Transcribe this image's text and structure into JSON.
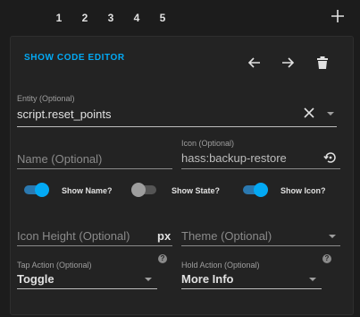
{
  "tabs": [
    "1",
    "2",
    "3",
    "4",
    "5"
  ],
  "editor": {
    "code_button": "SHOW CODE EDITOR"
  },
  "entity": {
    "label": "Entity (Optional)",
    "value": "script.reset_points"
  },
  "name": {
    "placeholder": "Name (Optional)"
  },
  "icon": {
    "label": "Icon (Optional)",
    "value": "hass:backup-restore"
  },
  "toggles": {
    "show_name": {
      "label": "Show Name?",
      "on": true
    },
    "show_state": {
      "label": "Show State?",
      "on": false
    },
    "show_icon": {
      "label": "Show Icon?",
      "on": true
    }
  },
  "icon_height": {
    "placeholder": "Icon Height (Optional)",
    "suffix": "px"
  },
  "theme": {
    "placeholder": "Theme (Optional)"
  },
  "tap_action": {
    "label": "Tap Action (Optional)",
    "value": "Toggle"
  },
  "hold_action": {
    "label": "Hold Action (Optional)",
    "value": "More Info"
  },
  "colors": {
    "accent": "#03a9f4",
    "background": "#1c1c1c",
    "card": "#232323"
  }
}
